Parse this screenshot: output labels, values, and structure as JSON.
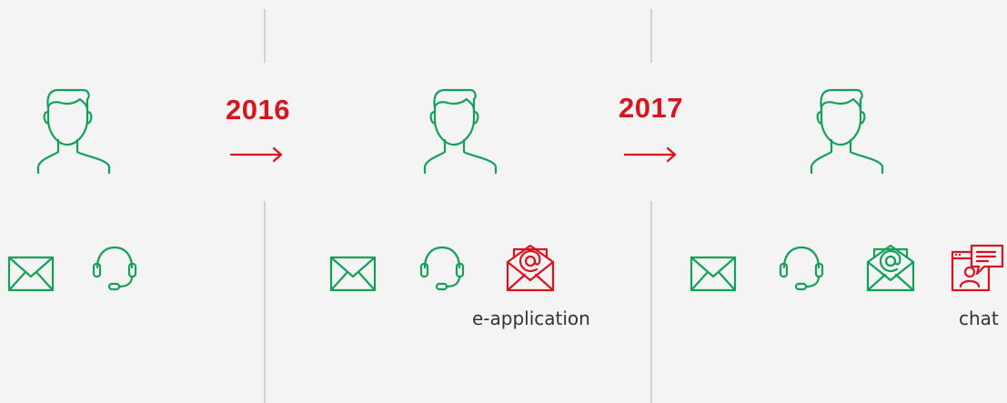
{
  "stages": [
    {
      "year": "",
      "channels": [
        "email",
        "phone"
      ],
      "new_channel_label": ""
    },
    {
      "year": "2016",
      "channels": [
        "email",
        "phone",
        "e-application"
      ],
      "new_channel_label": "e-application"
    },
    {
      "year": "2017",
      "channels": [
        "email",
        "phone",
        "e-application",
        "chat"
      ],
      "new_channel_label": "chat"
    }
  ],
  "transitions": [
    {
      "year": "2016"
    },
    {
      "year": "2017"
    }
  ],
  "colors": {
    "green": "#13a05a",
    "red": "#d8141f",
    "divider": "#d3d3d3",
    "background": "#f4f4f4"
  },
  "icons": [
    "person-icon",
    "envelope-icon",
    "headset-icon",
    "email-at-icon",
    "chat-window-icon",
    "arrow-right-icon"
  ]
}
